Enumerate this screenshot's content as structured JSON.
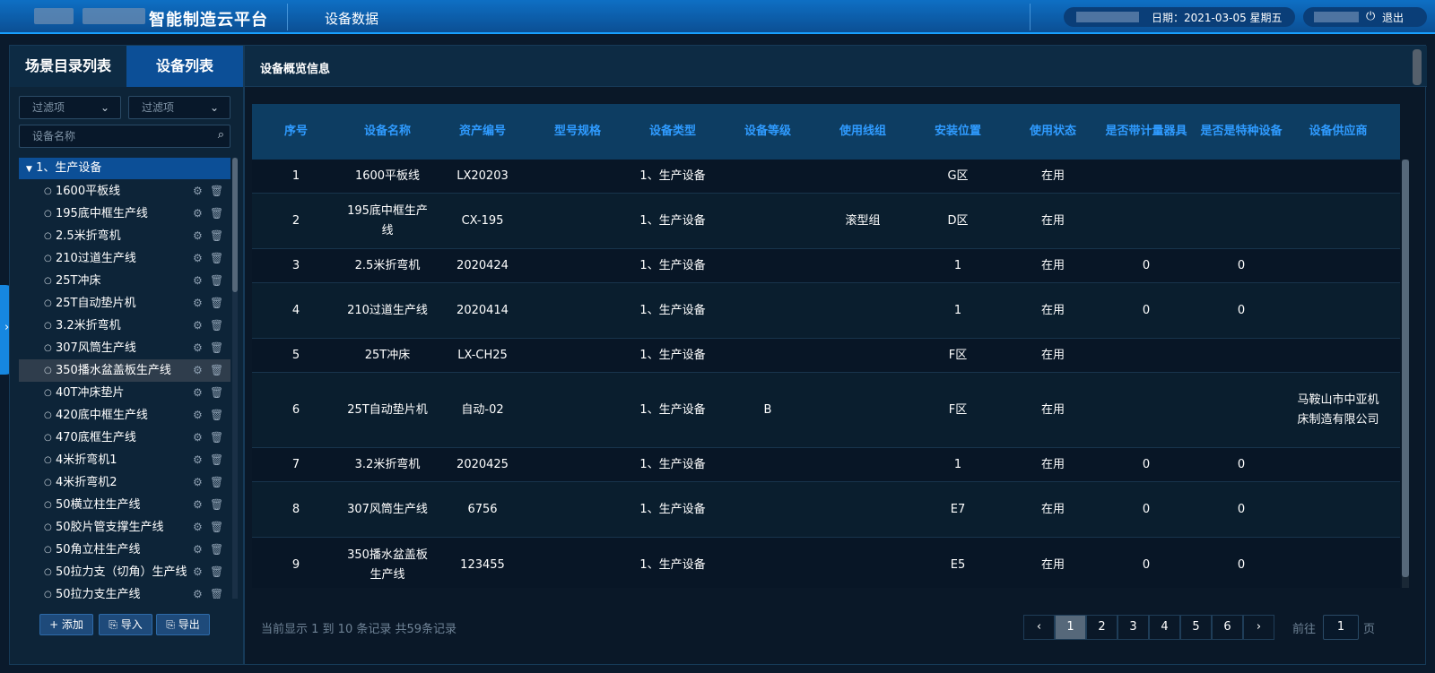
{
  "header": {
    "title": "智能制造云平台",
    "page_title": "设备数据",
    "date": "日期：2021-03-05  星期五",
    "logout": "退出"
  },
  "left": {
    "tabs": [
      "场景目录列表",
      "设备列表"
    ],
    "filter1": "过滤项",
    "filter2": "过滤项",
    "search_placeholder": "设备名称",
    "root": "1、生产设备",
    "items": [
      "1600平板线",
      "195底中框生产线",
      "2.5米折弯机",
      "210过道生产线",
      "25T冲床",
      "25T自动垫片机",
      "3.2米折弯机",
      "307风筒生产线",
      "350播水盆盖板生产线",
      "40T冲床垫片",
      "420底中框生产线",
      "470底框生产线",
      "4米折弯机1",
      "4米折弯机2",
      "50横立柱生产线",
      "50胶片管支撑生产线",
      "50角立柱生产线",
      "50拉力支（切角）生产线",
      "50拉力支生产线"
    ],
    "buttons": {
      "add": "+ 添加",
      "import": "导入",
      "export": "导出"
    }
  },
  "main": {
    "title": "设备概览信息",
    "columns": [
      "序号",
      "设备名称",
      "资产编号",
      "型号规格",
      "设备类型",
      "设备等级",
      "使用线组",
      "安装位置",
      "使用状态",
      "是否带计量器具",
      "是否是特种设备",
      "设备供应商"
    ],
    "rows": [
      [
        "1",
        "1600平板线",
        "LX20203",
        "",
        "1、生产设备",
        "",
        "",
        "G区",
        "在用",
        "",
        "",
        ""
      ],
      [
        "2",
        "195底中框生产线",
        "CX-195",
        "",
        "1、生产设备",
        "",
        "滚型组",
        "D区",
        "在用",
        "",
        "",
        ""
      ],
      [
        "3",
        "2.5米折弯机",
        "2020424",
        "",
        "1、生产设备",
        "",
        "",
        "1",
        "在用",
        "0",
        "0",
        ""
      ],
      [
        "4",
        "210过道生产线",
        "2020414",
        "",
        "1、生产设备",
        "",
        "",
        "1",
        "在用",
        "0",
        "0",
        ""
      ],
      [
        "5",
        "25T冲床",
        "LX-CH25",
        "",
        "1、生产设备",
        "",
        "",
        "F区",
        "在用",
        "",
        "",
        ""
      ],
      [
        "6",
        "25T自动垫片机",
        "自动-02",
        "",
        "1、生产设备",
        "B",
        "",
        "F区",
        "在用",
        "",
        "",
        "马鞍山市中亚机床制造有限公司"
      ],
      [
        "7",
        "3.2米折弯机",
        "2020425",
        "",
        "1、生产设备",
        "",
        "",
        "1",
        "在用",
        "0",
        "0",
        ""
      ],
      [
        "8",
        "307风筒生产线",
        "6756",
        "",
        "1、生产设备",
        "",
        "",
        "E7",
        "在用",
        "0",
        "0",
        ""
      ],
      [
        "9",
        "350播水盆盖板生产线",
        "123455",
        "",
        "1、生产设备",
        "",
        "",
        "E5",
        "在用",
        "0",
        "0",
        ""
      ]
    ],
    "records": "当前显示 1 到 10 条记录 共59条记录",
    "pagination": {
      "prev": "‹",
      "pages": [
        "1",
        "2",
        "3",
        "4",
        "5",
        "6"
      ],
      "next": "›",
      "current": "1",
      "goto_label": "前往",
      "goto_value": "1",
      "page_unit": "页"
    }
  },
  "icons": {
    "search": "search-icon",
    "gear": "gear-icon",
    "trash": "trash-icon",
    "power": "power-icon",
    "chevron": "chevron-down-icon"
  },
  "colors": {
    "accent": "#0c4f97",
    "header_text": "#2f9bff",
    "topbar": "#0b4f94"
  }
}
